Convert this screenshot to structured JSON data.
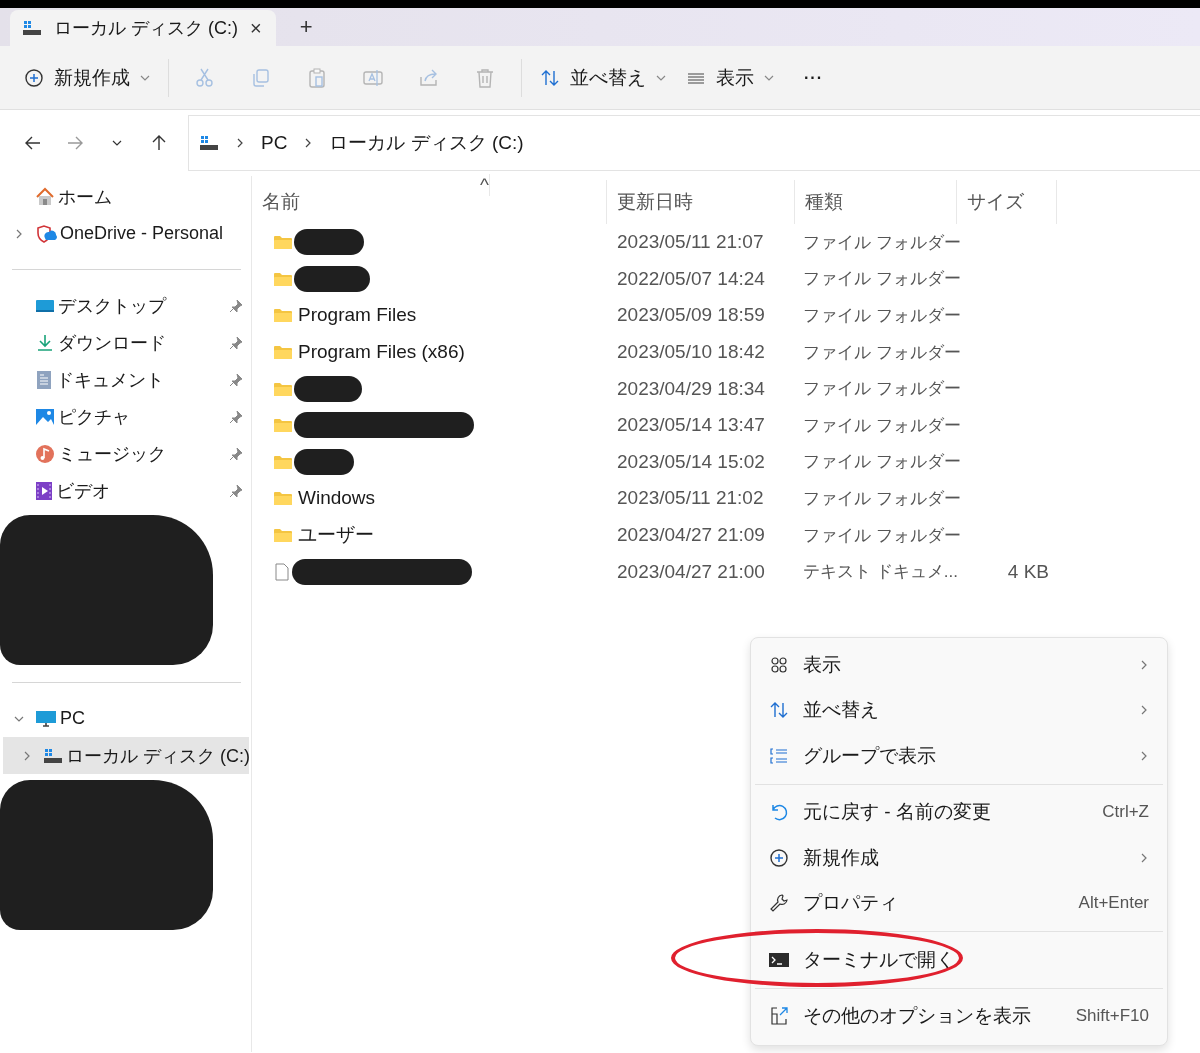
{
  "tabs": [
    {
      "label": "ローカル ディスク (C:)",
      "selected": true,
      "close": "×"
    }
  ],
  "new_tab": "+",
  "toolbar": {
    "items": [
      {
        "kind": "new",
        "label": "新規作成",
        "disabled": false
      },
      {
        "kind": "divider"
      },
      {
        "kind": "cut",
        "disabled": true
      },
      {
        "kind": "copy",
        "disabled": true
      },
      {
        "kind": "paste",
        "disabled": true
      },
      {
        "kind": "rename",
        "disabled": true
      },
      {
        "kind": "share",
        "disabled": true
      },
      {
        "kind": "delete",
        "disabled": true
      },
      {
        "kind": "divider"
      },
      {
        "kind": "sort",
        "label": "並べ替え",
        "disabled": false
      },
      {
        "kind": "view",
        "label": "表示",
        "disabled": false
      },
      {
        "kind": "more",
        "label": "···",
        "disabled": false
      }
    ]
  },
  "address": {
    "crumbs": [
      "PC",
      "ローカル ディスク (C:)"
    ],
    "back_disabled": false,
    "forward_disabled": true
  },
  "sidebar": {
    "items": [
      {
        "kind": "home",
        "label": "ホーム",
        "pinned": false,
        "selected": false
      },
      {
        "kind": "cloud",
        "label": "OneDrive - Personal",
        "expanded": false,
        "pinned": false,
        "selected": false
      },
      {
        "kind": "divider"
      },
      {
        "kind": "desktop",
        "label": "デスクトップ",
        "pinned": true,
        "selected": false
      },
      {
        "kind": "download",
        "label": "ダウンロード",
        "pinned": true,
        "selected": false
      },
      {
        "kind": "document",
        "label": "ドキュメント",
        "pinned": true,
        "selected": false
      },
      {
        "kind": "picture",
        "label": "ピクチャ",
        "pinned": true,
        "selected": false
      },
      {
        "kind": "music",
        "label": "ミュージック",
        "pinned": true,
        "selected": false
      },
      {
        "kind": "video",
        "label": "ビデオ",
        "pinned": true,
        "selected": false
      },
      {
        "kind": "redacted"
      },
      {
        "kind": "divider"
      },
      {
        "kind": "pc",
        "label": "PC",
        "expanded": true,
        "pinned": false,
        "selected": false,
        "children": [
          {
            "kind": "drive",
            "label": "ローカル ディスク (C:)",
            "expanded": false,
            "pinned": false,
            "selected": true
          }
        ]
      },
      {
        "kind": "redacted"
      }
    ]
  },
  "files": {
    "sort_indicator": "^",
    "columns": [
      "名前",
      "更新日時",
      "種類",
      "サイズ"
    ],
    "rows": [
      {
        "kind": "folder",
        "redacted": true,
        "modified": "2023/05/11 21:07",
        "type": "ファイル フォルダー"
      },
      {
        "kind": "folder",
        "redacted": true,
        "modified": "2022/05/07 14:24",
        "type": "ファイル フォルダー"
      },
      {
        "kind": "folder",
        "redacted": false,
        "name": "Program Files",
        "modified": "2023/05/09 18:59",
        "type": "ファイル フォルダー"
      },
      {
        "kind": "folder",
        "redacted": false,
        "name": "Program Files (x86)",
        "modified": "2023/05/10 18:42",
        "type": "ファイル フォルダー"
      },
      {
        "kind": "folder",
        "redacted": true,
        "modified": "2023/04/29 18:34",
        "type": "ファイル フォルダー"
      },
      {
        "kind": "folder",
        "redacted": true,
        "modified": "2023/05/14 13:47",
        "type": "ファイル フォルダー"
      },
      {
        "kind": "folder",
        "redacted": true,
        "modified": "2023/05/14 15:02",
        "type": "ファイル フォルダー"
      },
      {
        "kind": "folder",
        "redacted": false,
        "name": "Windows",
        "modified": "2023/05/11 21:02",
        "type": "ファイル フォルダー"
      },
      {
        "kind": "folder",
        "redacted": false,
        "name": "ユーザー",
        "modified": "2023/04/27 21:09",
        "type": "ファイル フォルダー"
      },
      {
        "kind": "file",
        "redacted": true,
        "modified": "2023/04/27 21:00",
        "type": "テキスト ドキュメ...",
        "size": "4 KB"
      }
    ]
  },
  "context_menu": {
    "items": [
      {
        "kind": "grid",
        "label": "表示",
        "submenu": true,
        "circled": false
      },
      {
        "kind": "sort",
        "label": "並べ替え",
        "submenu": true,
        "circled": false
      },
      {
        "kind": "group",
        "label": "グループで表示",
        "submenu": true,
        "circled": false
      },
      {
        "kind": "divider"
      },
      {
        "kind": "undo",
        "label": "元に戻す - 名前の変更",
        "shortcut": "Ctrl+Z",
        "submenu": false,
        "circled": false
      },
      {
        "kind": "new",
        "label": "新規作成",
        "submenu": true,
        "circled": false
      },
      {
        "kind": "wrench",
        "label": "プロパティ",
        "shortcut": "Alt+Enter",
        "submenu": false,
        "circled": false
      },
      {
        "kind": "divider"
      },
      {
        "kind": "terminal",
        "label": "ターミナルで開く",
        "submenu": false,
        "circled": true
      },
      {
        "kind": "divider"
      },
      {
        "kind": "external",
        "label": "その他のオプションを表示",
        "shortcut": "Shift+F10",
        "submenu": false,
        "circled": false
      }
    ]
  }
}
